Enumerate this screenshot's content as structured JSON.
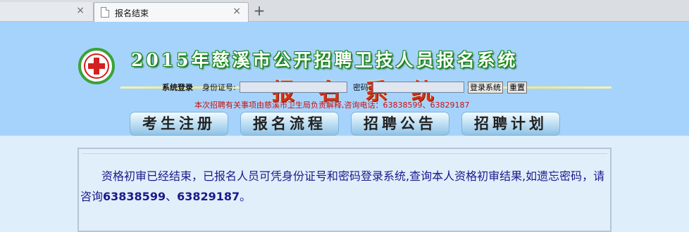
{
  "browser": {
    "tab_close_glyph": "×",
    "active_tab_title": "报名结束",
    "new_tab_glyph": "+"
  },
  "header": {
    "title": "2015年慈溪市公开招聘卫技人员报名系统",
    "subtitle": "报名系统"
  },
  "login": {
    "section_label": "系统登录",
    "id_label": "身份证号:",
    "id_value": "",
    "password_label": "密码:",
    "password_value": "",
    "login_button": "登录系统",
    "reset_button": "重置"
  },
  "notice": "本次招聘有关事项由慈溪市卫生局负责解释,咨询电话：63838599、63829187",
  "nav": {
    "items": [
      "考生注册",
      "报名流程",
      "招聘公告",
      "招聘计划"
    ]
  },
  "content": {
    "message_part1": "资格初审已经结束，已报名人员可凭身份证号和密码登录系统,查询本人资格初审结果,如遗忘密码，请咨询",
    "phone1": "63838599",
    "sep": "、",
    "phone2": "63829187",
    "end": "。"
  },
  "colors": {
    "banner": "#a6d3fc",
    "title_outline": "#128812",
    "subtitle": "#d9301a",
    "notice": "#cc1010",
    "message": "#1a1a8c"
  },
  "icons": [
    "document-icon",
    "close-icon",
    "plus-icon",
    "red-cross-logo"
  ]
}
